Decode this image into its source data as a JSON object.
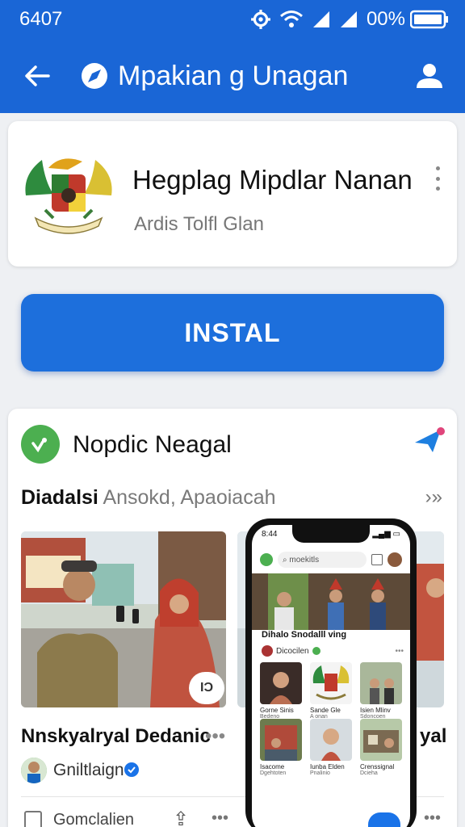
{
  "status_bar": {
    "time": "6407",
    "battery_text": "00%"
  },
  "toolbar": {
    "title": "Mpakian g Unagan"
  },
  "app": {
    "name": "Hegplag Mipdlar Nanan",
    "developer": "Ardis  Tolfl Glan"
  },
  "install_button": {
    "label": "INSTAL"
  },
  "section": {
    "title": "Nopdic Neagal",
    "subhead_bold": "Diadalsi",
    "subhead_light": "Ansokd, Apaoiacah",
    "more": "›»"
  },
  "post": {
    "play_label": "IƆ",
    "title": "Nnskyalryal Dedanic",
    "title_right": "yal",
    "dots": "•••",
    "author": "Gniltlaign"
  },
  "footer": {
    "text": "Gomclalien",
    "dots": "•••"
  },
  "phone": {
    "time": "8:44",
    "search_placeholder": "moekitls",
    "section_title": "Dihalo Snodalll ving",
    "row_label": "Dicocilen",
    "row_dots": "•••",
    "grid": [
      {
        "cap": "Gorne Sinis",
        "sub": "Bedeno"
      },
      {
        "cap": "Sande Gle",
        "sub": "A onan"
      },
      {
        "cap": "Isien Mlinv",
        "sub": "Sdoncoen"
      },
      {
        "cap": "Isacome",
        "sub": "Dgehtoten"
      },
      {
        "cap": "Iunba Elden",
        "sub": "Pnalinio"
      },
      {
        "cap": "Crenssignal",
        "sub": "Dcieha"
      }
    ]
  },
  "colors": {
    "app_bar": "#1a66d6",
    "install_button": "#1d6fdc",
    "section_icon": "#4caf50"
  }
}
